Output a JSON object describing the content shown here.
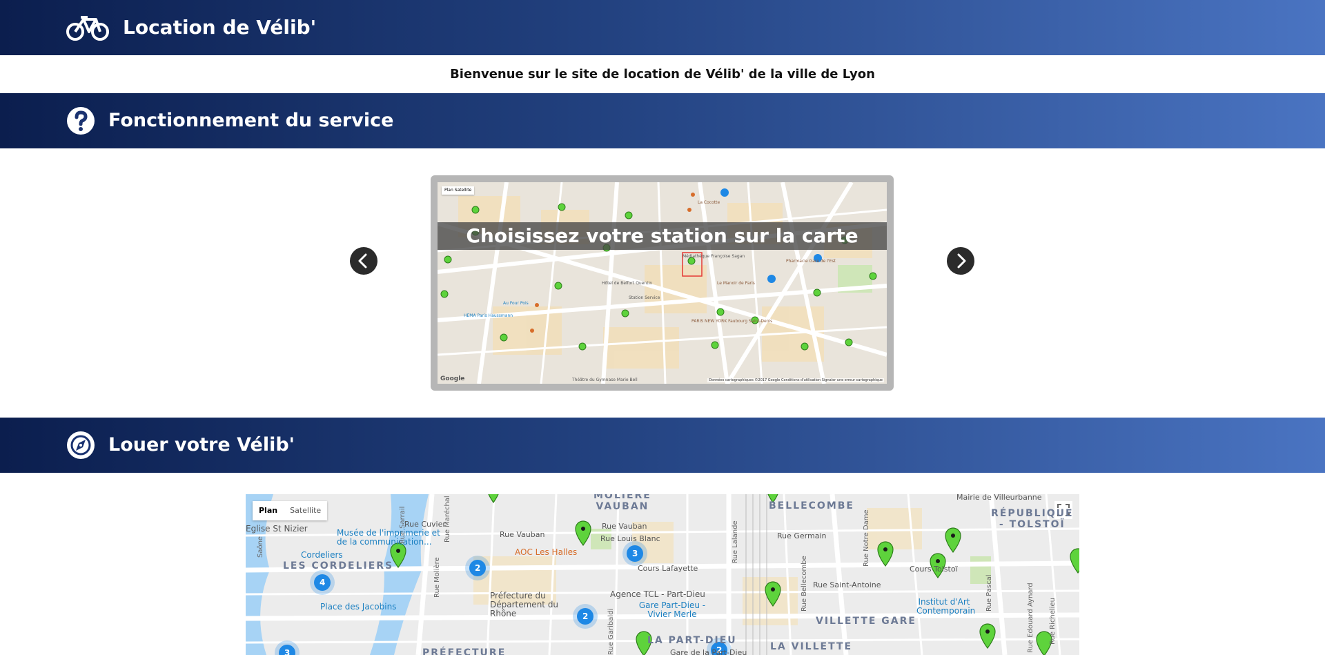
{
  "header": {
    "title": "Location de Vélib'",
    "icon": "bicycle-icon"
  },
  "welcome_text": "Bienvenue sur le site de location de Vélib' de la ville de Lyon",
  "service_section": {
    "title": "Fonctionnement du service",
    "icon": "question-circle-icon",
    "slider": {
      "caption": "Choisissez votre station sur la carte",
      "prev_icon": "chevron-left-icon",
      "next_icon": "chevron-right-icon",
      "mini_map": {
        "maptype_plan": "Plan",
        "maptype_satellite": "Satellite",
        "attribution": "Données cartographiques ©2017 Google   Conditions d'utilisation   Signaler une erreur cartographique",
        "google_logo": "Google",
        "labels": [
          "Pharmacie Gare de l'Est",
          "Le Manoir de Paris",
          "Hôtel de Belfort Quentin",
          "Station Service",
          "Au Four Pois",
          "HEMA Paris Haussmann",
          "PARIS NEW YORK Faubourg Saint-Denis",
          "Théâtre du Gymnase Marie Bell",
          "La Cocotte",
          "Médiathèque Françoise Sagan"
        ]
      }
    }
  },
  "rent_section": {
    "title": "Louer votre Vélib'",
    "icon": "compass-icon"
  },
  "rent_map": {
    "maptype_plan": "Plan",
    "maptype_satellite": "Satellite",
    "fullscreen_icon": "fullscreen-icon",
    "labels": {
      "moliere_vauban": "MOLIÈRE\nVAUBAN",
      "bellecombe": "BELLECOMBE",
      "republique": "RÉPUBLIQUE\n- TOLSTOÏ",
      "les_cordeliers": "LES CORDELIERS",
      "villette_gare": "VILLETTE GARE",
      "la_villette": "LA VILLETTE",
      "la_part_dieu": "LA PART-DIEU",
      "prefecture": "PRÉFECTURE",
      "eglise_st_nizier": "Eglise St Nizier",
      "musee_imprimerie": "Musée de l'imprimerie et de la communication...",
      "cordeliers": "Cordeliers",
      "place_jacobins": "Place des Jacobins",
      "aoc_halles": "AOC Les Halles",
      "cours_lafayette": "Cours Lafayette",
      "agence_tcl": "Agence TCL - Part-Dieu",
      "gare_part_dieu": "Gare Part-Dieu - Vivier Merle",
      "prefecture_rhone": "Préfecture du Département du Rhône",
      "institut_art": "Institut d'Art Contemporain",
      "rue_vauban": "Rue Vauban",
      "rue_louis_blanc": "Rue Louis Blanc",
      "rue_germain": "Rue Germain",
      "cours_tolstoi": "Cours Tolstoï",
      "rue_saint_antoine": "Rue Saint-Antoine",
      "gare_part_dieu_short": "Gare de la Part-Dieu",
      "mairie": "Mairie de Villeurbanne",
      "rue_lalande": "Rue Lalande",
      "rue_bellecombe": "Rue Bellecombe",
      "rue_garibaldi": "Rue Garibaldi",
      "rue_notre_dame": "Rue Notre Dame",
      "rue_richelieu": "Rue Richelieu",
      "rue_pascal": "Rue Pascal",
      "rue_edouard_aynard": "Rue Edouard Aynard",
      "rue_marechal": "Rue Maréchal de Saxe",
      "rue_cuvier": "Rue Cuvier",
      "rue_sarrail": "Rue Sarrail",
      "rue_moliere": "Rue Molière",
      "saone": "Saône"
    },
    "clusters": [
      "4",
      "2",
      "3",
      "2",
      "2",
      "3"
    ],
    "colors": {
      "pin": "#5ed33c",
      "cluster": "#1e88e5",
      "water": "#a7d3f5"
    }
  }
}
